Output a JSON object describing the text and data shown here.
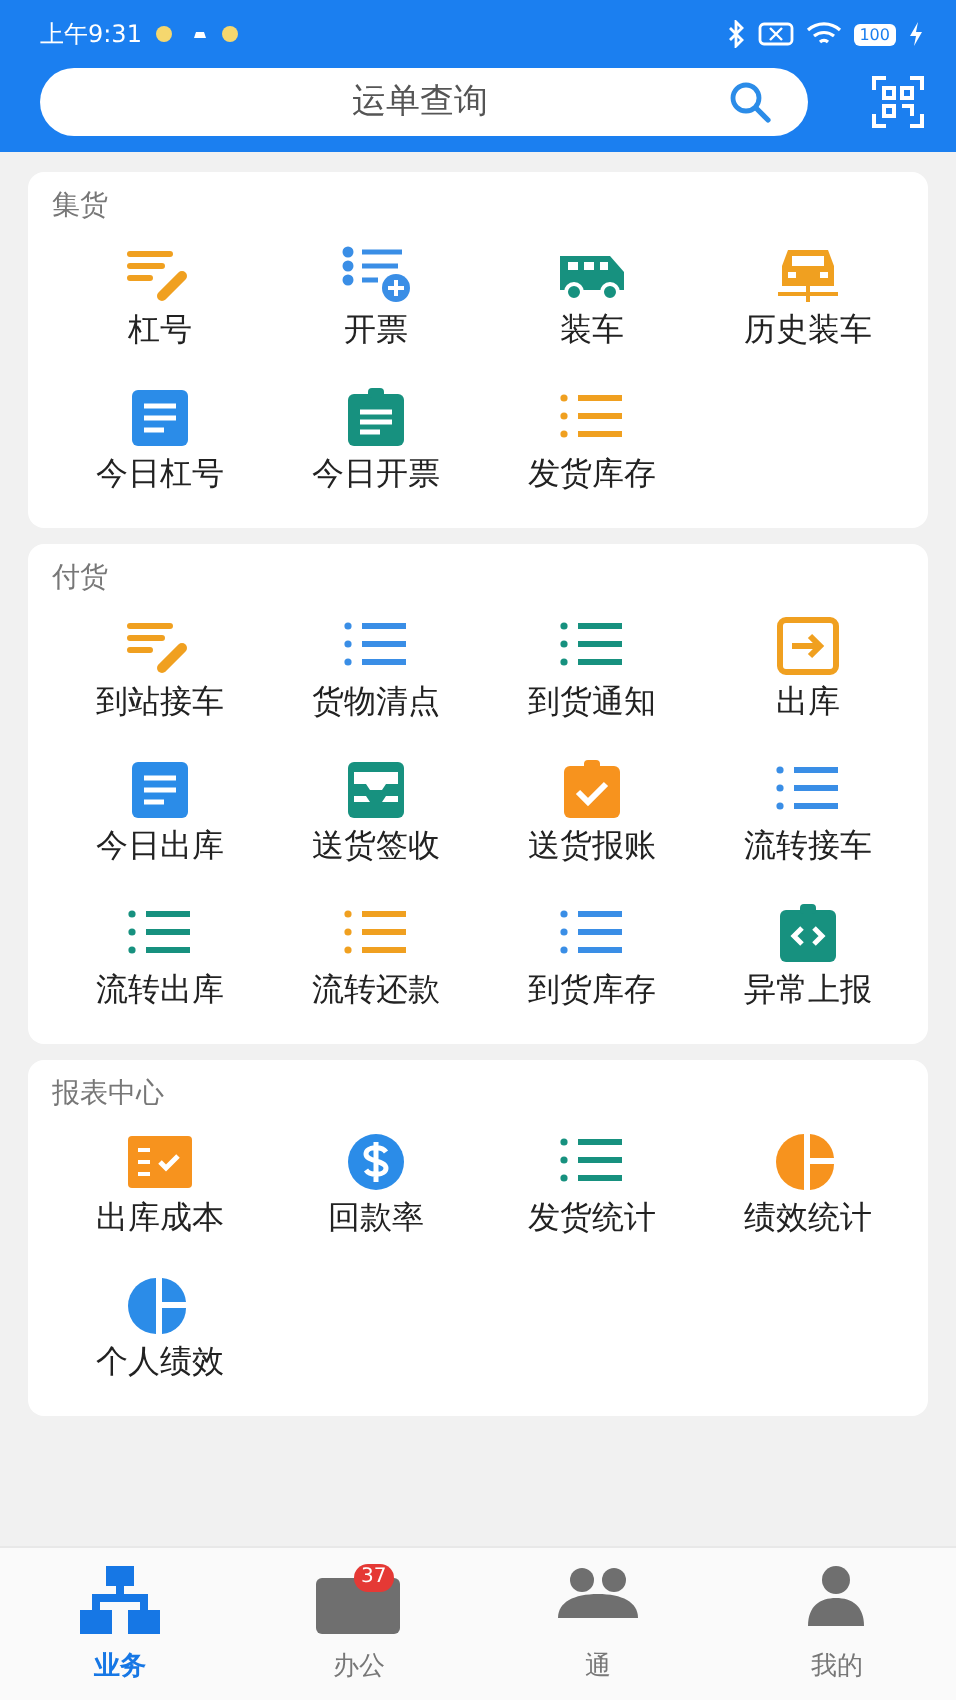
{
  "status_bar": {
    "time": "上午9:31",
    "battery": "100"
  },
  "search": {
    "placeholder": "运单查询"
  },
  "sections": [
    {
      "title": "集货",
      "items": [
        {
          "label": "杠号",
          "kind": "pencil-lines",
          "color": "#f0a020"
        },
        {
          "label": "开票",
          "kind": "list-plus",
          "color": "#3a8ee6"
        },
        {
          "label": "装车",
          "kind": "van",
          "color": "#17917f"
        },
        {
          "label": "历史装车",
          "kind": "car",
          "color": "#f0a020"
        },
        {
          "label": "今日杠号",
          "kind": "doc",
          "color": "#2b8ce8"
        },
        {
          "label": "今日开票",
          "kind": "clipboard",
          "color": "#17917f"
        },
        {
          "label": "发货库存",
          "kind": "list",
          "color": "#f0a020"
        }
      ]
    },
    {
      "title": "付货",
      "items": [
        {
          "label": "到站接车",
          "kind": "pencil-lines",
          "color": "#f0a020"
        },
        {
          "label": "货物清点",
          "kind": "list",
          "color": "#3a8ee6"
        },
        {
          "label": "到货通知",
          "kind": "list",
          "color": "#17917f"
        },
        {
          "label": "出库",
          "kind": "enter",
          "color": "#f0a020"
        },
        {
          "label": "今日出库",
          "kind": "doc",
          "color": "#2b8ce8"
        },
        {
          "label": "送货签收",
          "kind": "tray",
          "color": "#17917f"
        },
        {
          "label": "送货报账",
          "kind": "check-clipboard",
          "color": "#f7931e"
        },
        {
          "label": "流转接车",
          "kind": "list",
          "color": "#3a8ee6"
        },
        {
          "label": "流转出库",
          "kind": "list",
          "color": "#17917f"
        },
        {
          "label": "流转还款",
          "kind": "list",
          "color": "#f0a020"
        },
        {
          "label": "到货库存",
          "kind": "list",
          "color": "#3a8ee6"
        },
        {
          "label": "异常上报",
          "kind": "code-clipboard",
          "color": "#17917f"
        }
      ]
    },
    {
      "title": "报表中心",
      "items": [
        {
          "label": "出库成本",
          "kind": "checklist",
          "color": "#f7931e"
        },
        {
          "label": "回款率",
          "kind": "dollar",
          "color": "#2b8ce8"
        },
        {
          "label": "发货统计",
          "kind": "list",
          "color": "#17917f"
        },
        {
          "label": "绩效统计",
          "kind": "pie",
          "color": "#f7931e"
        },
        {
          "label": "个人绩效",
          "kind": "pie",
          "color": "#2b8ce8"
        }
      ]
    }
  ],
  "bottom_nav": [
    {
      "label": "业务",
      "kind": "org",
      "selected": true
    },
    {
      "label": "办公",
      "kind": "case",
      "selected": false,
      "badge": "37"
    },
    {
      "label": "通",
      "kind": "people",
      "selected": false
    },
    {
      "label": "我的",
      "kind": "person",
      "selected": false
    }
  ]
}
